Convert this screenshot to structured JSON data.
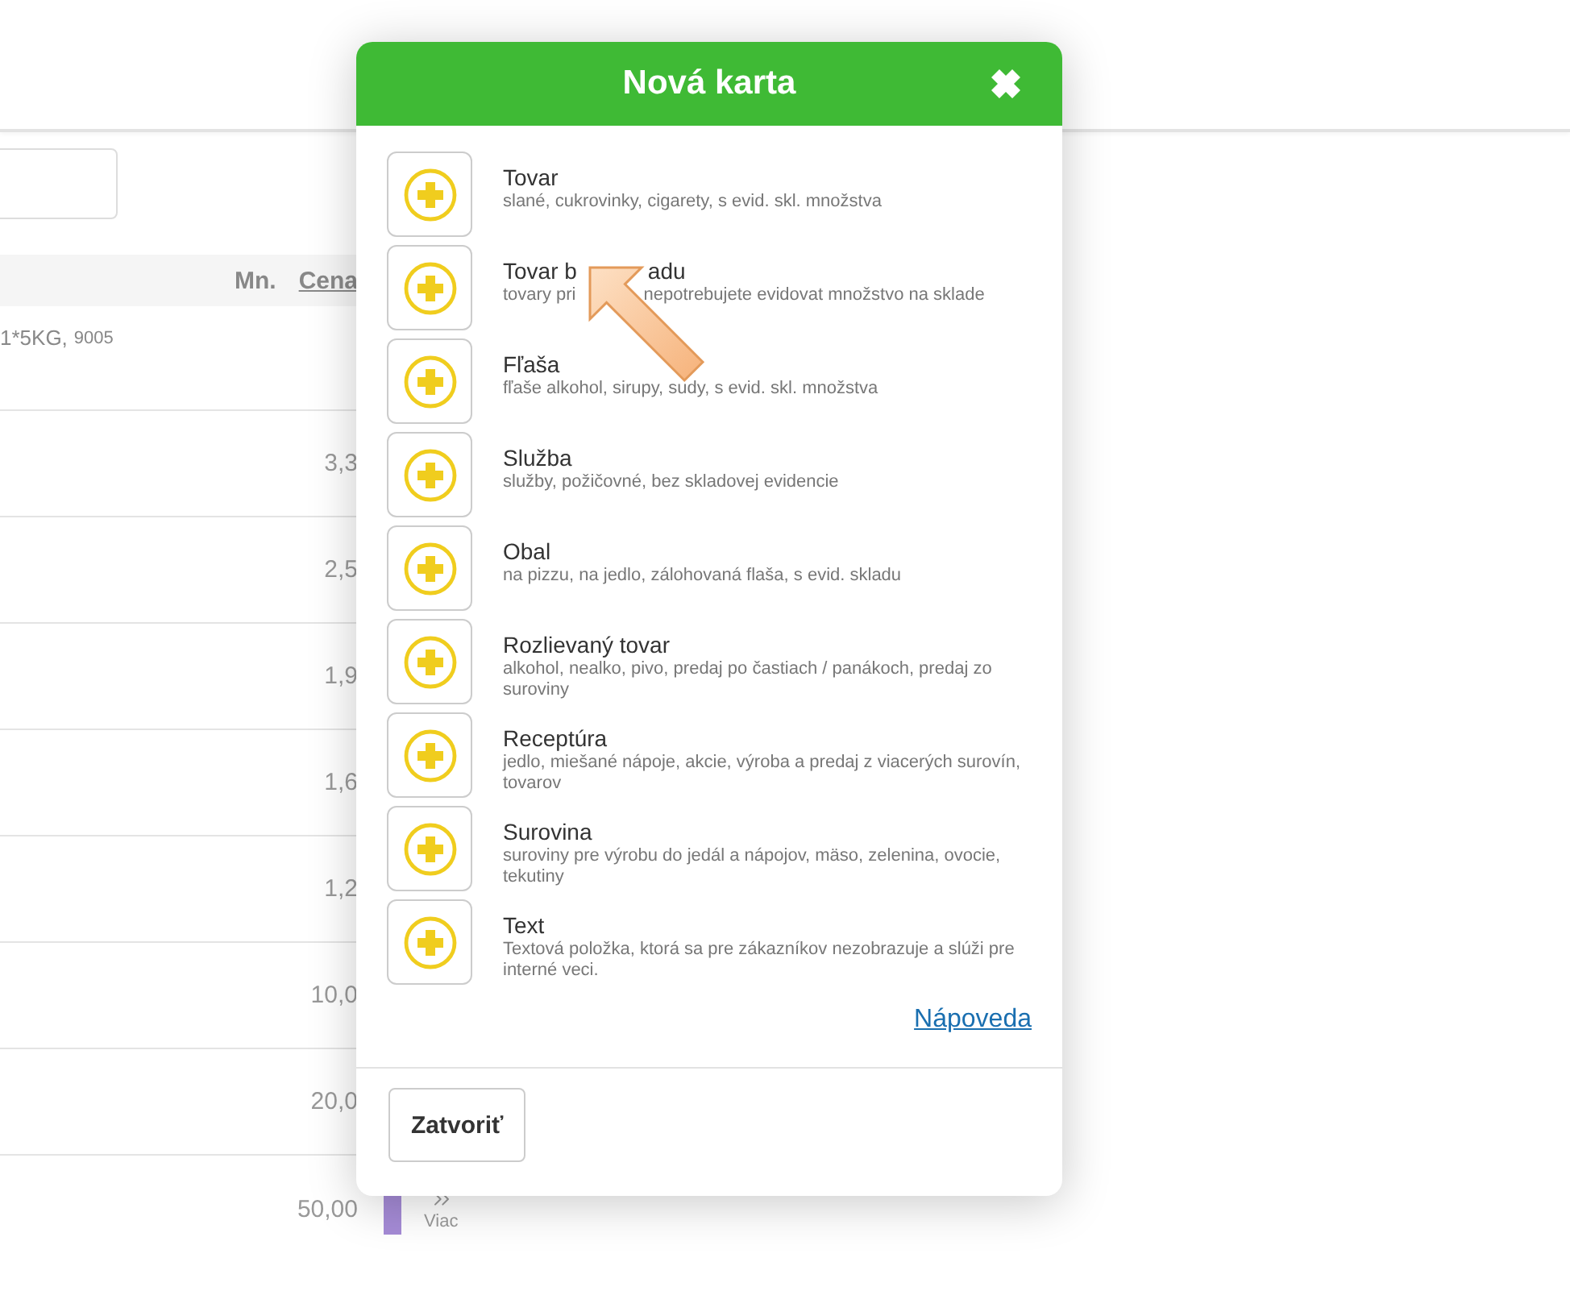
{
  "table": {
    "columns": [
      {
        "label": "Mn.",
        "underlined": false
      },
      {
        "label": "Cena",
        "underlined": true
      }
    ],
    "rows": [
      {
        "detail": "1*5KG,",
        "code": "9005"
      },
      {
        "price": "3,3"
      },
      {
        "price": "2,5"
      },
      {
        "price": "1,9"
      },
      {
        "price": "1,6"
      },
      {
        "price": "1,2"
      },
      {
        "price": "10,0"
      },
      {
        "price": "20,0"
      },
      {
        "price": "50,00",
        "more_label": "Viac"
      }
    ]
  },
  "dialog": {
    "title": "Nová karta",
    "items": [
      {
        "title": "Tovar",
        "description": "slané, cukrovinky, cigarety, s evid. skl. množstva"
      },
      {
        "title": "Tovar b",
        "title_rest": "adu",
        "description": "tovary pri",
        "description_rest": "nepotrebujete evidovat množstvo na sklade"
      },
      {
        "title": "Fľaša",
        "description": "fľaše alkohol, sirupy, sudy, s evid. skl. množstva"
      },
      {
        "title": "Služba",
        "description": "služby, požičovné, bez skladovej evidencie"
      },
      {
        "title": "Obal",
        "description": "na pizzu, na jedlo, zálohovaná flaša, s evid. skladu"
      },
      {
        "title": "Rozlievaný tovar",
        "description": "alkohol, nealko, pivo, predaj po častiach / panákoch, predaj zo suroviny"
      },
      {
        "title": "Receptúra",
        "description": "jedlo, miešané nápoje, akcie, výroba a predaj z viacerých surovín, tovarov"
      },
      {
        "title": "Surovina",
        "description": "suroviny pre výrobu do jedál a nápojov, mäso, zelenina, ovocie, tekutiny"
      },
      {
        "title": "Text",
        "description": "Textová položka, ktorá sa pre zákazníkov nezobrazuje a slúži pre interné veci."
      }
    ],
    "help_link": "Nápoveda",
    "close_button": "Zatvoriť"
  }
}
